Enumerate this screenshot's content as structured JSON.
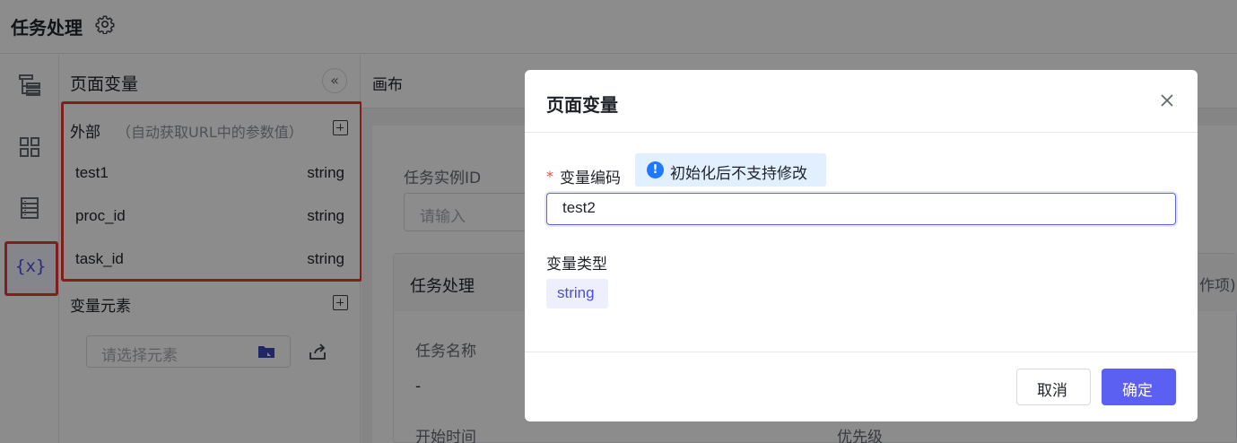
{
  "header": {
    "title": "任务处理",
    "settings_icon": "gear-icon"
  },
  "rail": {
    "icons": [
      "tree-icon",
      "grid-icon",
      "list-icon",
      "variable-icon"
    ],
    "active_label": "{x}"
  },
  "panel": {
    "title": "页面变量",
    "collapse_label": "«",
    "external": {
      "label": "外部",
      "hint": "（自动获取URL中的参数值）",
      "items": [
        {
          "name": "test1",
          "type": "string"
        },
        {
          "name": "proc_id",
          "type": "string"
        },
        {
          "name": "task_id",
          "type": "string"
        }
      ]
    },
    "elements": {
      "label": "变量元素",
      "select_placeholder": "请选择元素"
    }
  },
  "canvas": {
    "label": "画布",
    "instance_label": "任务实例ID",
    "instance_placeholder": "请输入",
    "card_title": "任务处理",
    "card_right": "作项)",
    "task_name_label": "任务名称",
    "task_name_value": "-",
    "start_time_label": "开始时间",
    "priority_label": "优先级"
  },
  "modal": {
    "title": "页面变量",
    "code_required_mark": "*",
    "code_label": "变量编码",
    "notice_icon": "!",
    "notice": "初始化后不支持修改",
    "code_value": "test2",
    "type_label": "变量类型",
    "type_value": "string",
    "cancel": "取消",
    "ok": "确定"
  },
  "colors": {
    "accent": "#5b5ff2",
    "highlight": "#e53935",
    "notice_bg": "#e1efff"
  }
}
